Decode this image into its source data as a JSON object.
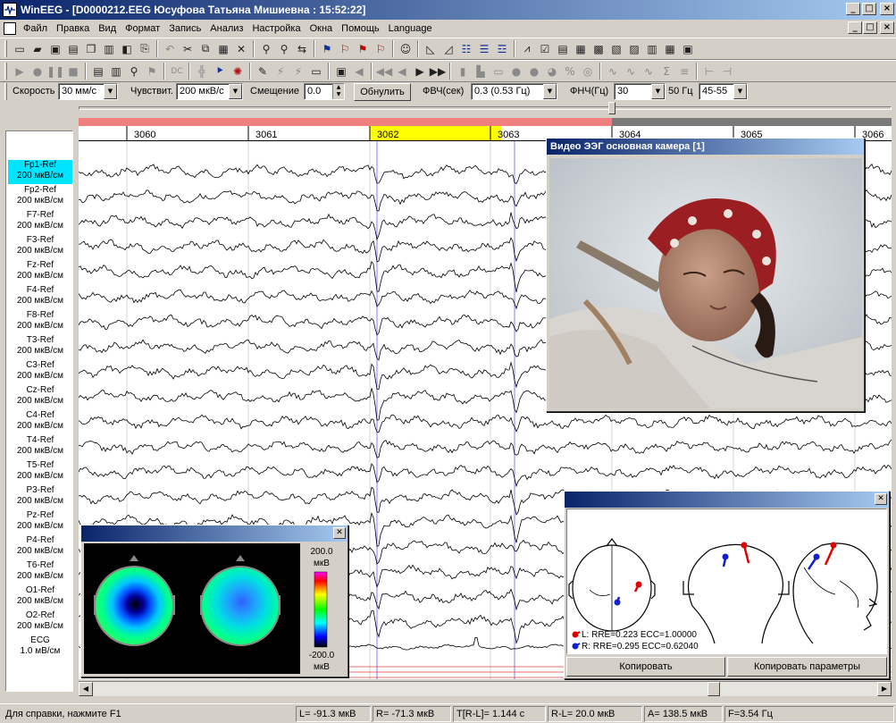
{
  "window": {
    "title": "WinEEG - [D0000212.EEG Юсуфова  Татьяна  Мишиевна : 15:52:22]",
    "buttons": {
      "minimize": "_",
      "maximize": "□",
      "close": "×"
    }
  },
  "menu": {
    "items": [
      "Файл",
      "Правка",
      "Вид",
      "Формат",
      "Запись",
      "Анализ",
      "Настройка",
      "Окна",
      "Помощь",
      "Language"
    ]
  },
  "toolbar1": {
    "icons": [
      "new-icon",
      "open-icon",
      "save-icon",
      "save-as-icon",
      "copy-file-icon",
      "print-icon",
      "print-preview-icon",
      "export-icon",
      "undo-icon",
      "cut-icon",
      "copy-icon",
      "paste-icon",
      "delete-icon",
      "find-icon",
      "find-next-icon",
      "replace-icon",
      "label-icon",
      "label-delete-icon",
      "label-next-icon",
      "label-prev-icon",
      "patient-icon",
      "montage-icon",
      "filter-icon",
      "average-icon",
      "reference-icon",
      "spectrum-icon",
      "properties-icon",
      "table-icon",
      "report-icon",
      "chart-icon",
      "map-icon",
      "image-icon",
      "print-report-icon"
    ]
  },
  "toolbar2": {
    "icons": [
      "play-icon",
      "record-icon",
      "stop-icon",
      "pause-icon",
      "montage-view-icon",
      "display-icon",
      "zoom-icon",
      "marker-icon",
      "dc-icon",
      "grid-icon",
      "photo-stim-icon",
      "stim-icon",
      "edit-icon",
      "mark-icon",
      "calibration-icon",
      "test-icon",
      "video-icon",
      "audio-icon",
      "rewind-icon",
      "step-back-icon",
      "step-forward-icon",
      "fast-forward-icon",
      "bar-chart-icon",
      "bar-chart-2-icon",
      "window-icon",
      "circle-icon",
      "filled-circle-icon",
      "pie-icon",
      "percent-icon",
      "target-icon",
      "wave-icon",
      "wave-2-icon",
      "wave-3-icon",
      "sum-icon",
      "epoch-icon",
      "split-icon"
    ]
  },
  "params": {
    "speed_label": "Скорость",
    "speed_value": "30 мм/с",
    "sens_label": "Чувствит.",
    "sens_value": "200 мкВ/с",
    "offset_label": "Смещение",
    "offset_value": "0.0",
    "reset_button": "Обнулить",
    "hpf_label": "ФВЧ(сек)",
    "hpf_value": "0.3  (0.53 Гц)",
    "lpf_label": "ФНЧ(Гц)",
    "lpf_value": "30",
    "notch_label": "50 Гц",
    "notch_value": "45-55"
  },
  "timeline": {
    "marks": [
      "3060",
      "3061",
      "3062",
      "3063",
      "3064",
      "3065",
      "3066"
    ],
    "highlight_color": "#ffff00"
  },
  "channels": [
    {
      "name": "Fp1-Ref",
      "gain": "200 мкВ/см"
    },
    {
      "name": "Fp2-Ref",
      "gain": "200 мкВ/см"
    },
    {
      "name": "F7-Ref",
      "gain": "200 мкВ/см"
    },
    {
      "name": "F3-Ref",
      "gain": "200 мкВ/см"
    },
    {
      "name": "Fz-Ref",
      "gain": "200 мкВ/см"
    },
    {
      "name": "F4-Ref",
      "gain": "200 мкВ/см"
    },
    {
      "name": "F8-Ref",
      "gain": "200 мкВ/см"
    },
    {
      "name": "T3-Ref",
      "gain": "200 мкВ/см"
    },
    {
      "name": "C3-Ref",
      "gain": "200 мкВ/см"
    },
    {
      "name": "Cz-Ref",
      "gain": "200 мкВ/см"
    },
    {
      "name": "C4-Ref",
      "gain": "200 мкВ/см"
    },
    {
      "name": "T4-Ref",
      "gain": "200 мкВ/см"
    },
    {
      "name": "T5-Ref",
      "gain": "200 мкВ/см"
    },
    {
      "name": "P3-Ref",
      "gain": "200 мкВ/см"
    },
    {
      "name": "Pz-Ref",
      "gain": "200 мкВ/см"
    },
    {
      "name": "P4-Ref",
      "gain": "200 мкВ/см"
    },
    {
      "name": "T6-Ref",
      "gain": "200 мкВ/см"
    },
    {
      "name": "O1-Ref",
      "gain": "200 мкВ/см"
    },
    {
      "name": "O2-Ref",
      "gain": "200 мкВ/см"
    },
    {
      "name": "ECG",
      "gain": "1.0 мВ/см"
    }
  ],
  "video_window": {
    "title": "Видео ЭЭГ основная камера [1]"
  },
  "dipole_window": {
    "left_result": "L: RRE=0.223 ECC=1.00000",
    "right_result": "R: RRE=0.295 ECC=0.62040",
    "copy_button": "Копировать",
    "copy_params_button": "Копировать параметры",
    "left_color": "#e00000",
    "right_color": "#1020d0"
  },
  "map_window": {
    "scale_max": "200.0",
    "scale_unit_top": "мкВ",
    "scale_min": "-200.0",
    "scale_unit_bottom": "мкВ"
  },
  "status": {
    "help": "Для справки, нажмите F1",
    "l_value": "L=  -91.3 мкВ",
    "r_value": "R=  -71.3 мкВ",
    "t_value": "T[R-L]= 1.144 c",
    "rl_value": "R-L=   20.0 мкВ",
    "a_value": "A=  138.5 мкВ",
    "f_value": "F=3.54 Гц"
  }
}
